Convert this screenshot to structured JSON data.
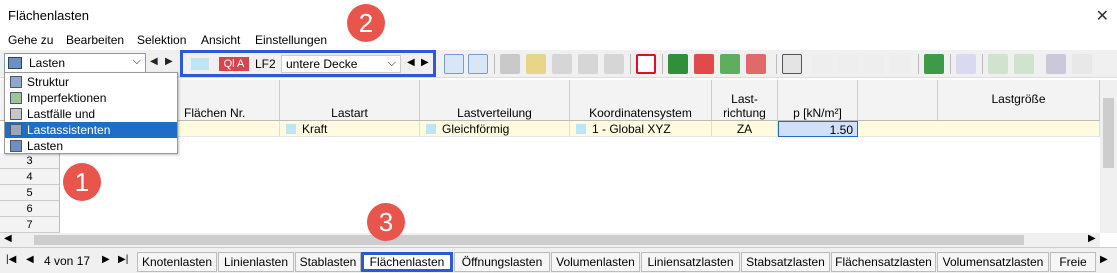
{
  "window": {
    "title": "Flächenlasten",
    "close": "✕"
  },
  "menu": [
    "Gehe zu",
    "Bearbeiten",
    "Selektion",
    "Ansicht",
    "Einstellungen"
  ],
  "nav": {
    "current": "Lasten",
    "items": [
      "Struktur",
      "Imperfektionen",
      "Lastfälle und Kombinationen",
      "Lastassistenten",
      "Lasten"
    ],
    "selected": "Lastassistenten"
  },
  "loadcase": {
    "tag": "Ql A",
    "id": "LF2",
    "name": "untere Decke"
  },
  "table": {
    "headers": {
      "area": "Flächen Nr.",
      "type": "Lastart",
      "dist": "Lastverteilung",
      "coord": "Koordinatensystem",
      "dir_top": "Last-",
      "dir_bot": "richtung",
      "p": "p [kN/m²]",
      "group": "Lastgröße"
    },
    "row1": {
      "type": "Kraft",
      "dist": "Gleichförmig",
      "coord": "1 - Global XYZ",
      "dir": "ZA",
      "p": "1.50"
    },
    "rownums": [
      "3",
      "4",
      "5",
      "6",
      "7"
    ]
  },
  "pager": {
    "label": "4 von 17"
  },
  "tabs": [
    "Knotenlasten",
    "Linienlasten",
    "Stablasten",
    "Flächenlasten",
    "Öffnungslasten",
    "Volumenlasten",
    "Liniensatzlasten",
    "Stabsatzlasten",
    "Flächensatzlasten",
    "Volumensatzlasten",
    "Freie"
  ],
  "activeTab": "Flächenlasten",
  "badges": [
    "1",
    "2",
    "3"
  ],
  "colors": {
    "highlight": "#2a5bd7",
    "badge": "#e7554c",
    "selection": "#1e6ec8"
  }
}
